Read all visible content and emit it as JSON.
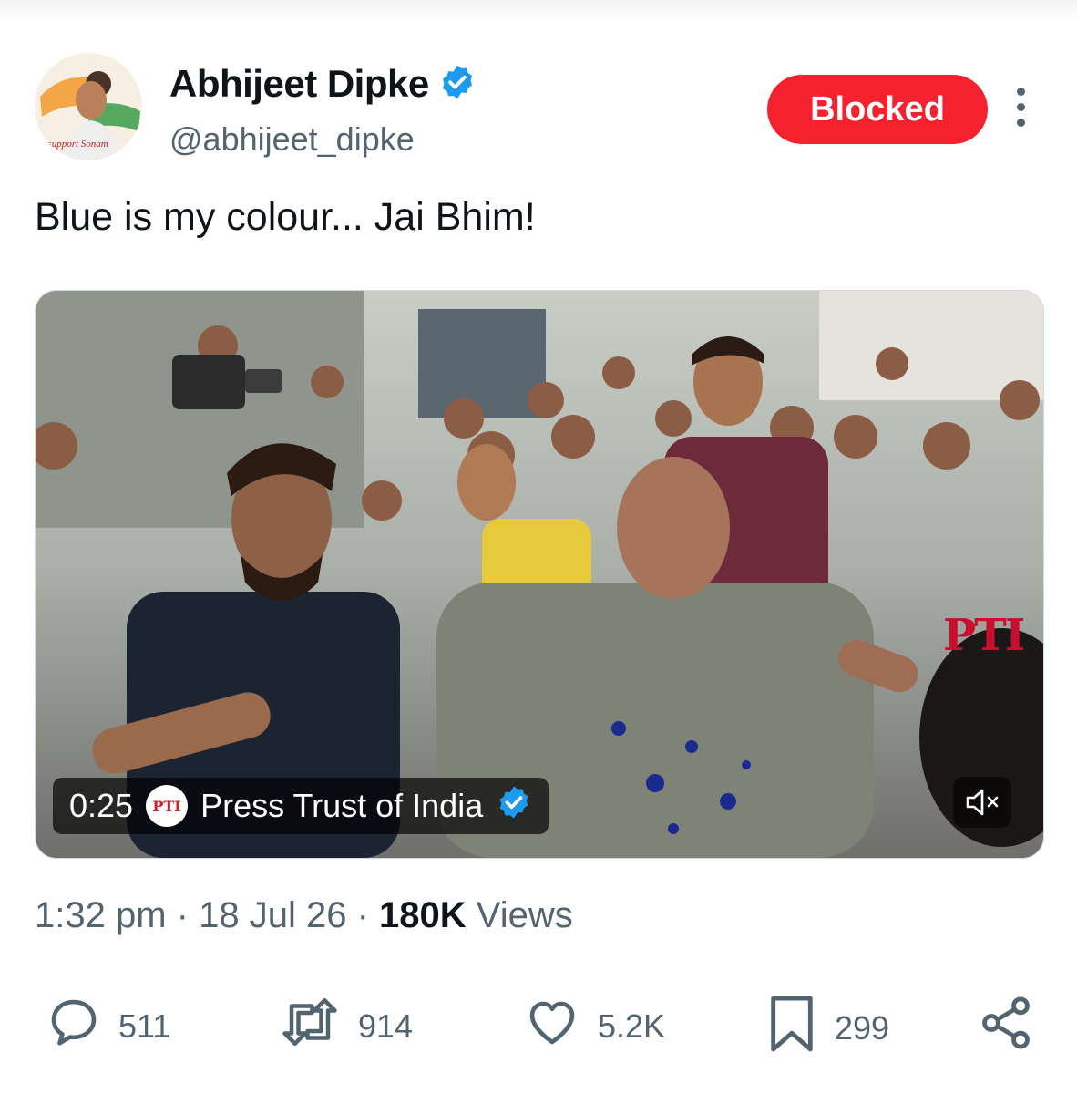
{
  "author": {
    "name": "Abhijeet Dipke",
    "handle": "@abhijeet_dipke",
    "avatar_caption": "I support Sonam",
    "verified": true
  },
  "header": {
    "blocked_label": "Blocked"
  },
  "tweet": {
    "text": "Blue is my colour... Jai Bhim!"
  },
  "media": {
    "duration": "0:25",
    "source_name": "Press Trust of India",
    "source_logo": "PTI",
    "watermark": "PTI"
  },
  "meta": {
    "time": "1:32 pm",
    "date": "18 Jul 26",
    "views_count": "180K",
    "views_label": "Views"
  },
  "actions": {
    "replies": "511",
    "reposts": "914",
    "likes": "5.2K",
    "bookmarks": "299"
  },
  "colors": {
    "blocked_red": "#f4212e",
    "verified_blue": "#1d9bf0",
    "secondary_text": "#536471"
  }
}
